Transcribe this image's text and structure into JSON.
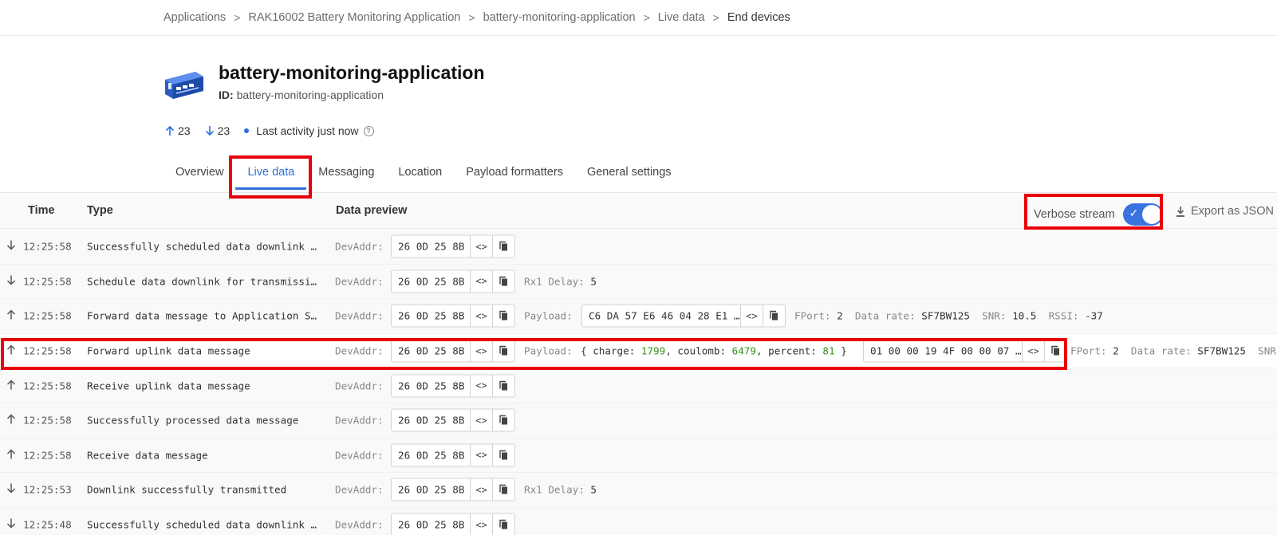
{
  "breadcrumb": {
    "items": [
      "Applications",
      "RAK16002 Battery Monitoring Application",
      "battery-monitoring-application",
      "Live data",
      "End devices"
    ],
    "separator": ">"
  },
  "header": {
    "title": "battery-monitoring-application",
    "id_label": "ID:",
    "id_value": "battery-monitoring-application",
    "icon": "device-board-icon"
  },
  "stats": {
    "uplink_count": "23",
    "downlink_count": "23",
    "activity": "Last activity just now",
    "help": "?"
  },
  "tabs": [
    "Overview",
    "Live data",
    "Messaging",
    "Location",
    "Payload formatters",
    "General settings"
  ],
  "active_tab": "Live data",
  "table": {
    "headers": {
      "time": "Time",
      "type": "Type",
      "preview": "Data preview"
    },
    "verbose_label": "Verbose stream",
    "verbose_check": "✓",
    "verbose_on": true,
    "export_label": "Export as JSON",
    "devaddr_label": "DevAddr:",
    "code_glyph": "<>"
  },
  "rows": [
    {
      "dir": "down",
      "time": "12:25:58",
      "type": "Successfully scheduled data downlink …",
      "devaddr": "26 0D 25 8B"
    },
    {
      "dir": "down",
      "time": "12:25:58",
      "type": "Schedule data downlink for transmissi…",
      "devaddr": "26 0D 25 8B",
      "rx_label": "Rx1 Delay:",
      "rx_value": "5"
    },
    {
      "dir": "up",
      "time": "12:25:58",
      "type": "Forward data message to Application S…",
      "devaddr": "26 0D 25 8B",
      "payload_label": "Payload:",
      "payload_hex": "C6 DA 57 E6 46 04 28 E1 …",
      "fport_label": "FPort:",
      "fport": "2",
      "datarate_label": "Data rate:",
      "datarate": "SF7BW125",
      "snr_label": "SNR:",
      "snr": "10.5",
      "rssi_label": "RSSI:",
      "rssi": "-37"
    },
    {
      "dir": "up",
      "time": "12:25:58",
      "type": "Forward uplink data message",
      "devaddr": "26 0D 25 8B",
      "payload_label": "Payload:",
      "decoded_open": "{",
      "charge_key": "charge:",
      "charge": "1799",
      "coulomb_key": "coulomb:",
      "coulomb": "6479",
      "percent_key": "percent:",
      "percent": "81",
      "decoded_close": "}",
      "payload_hex": "01 00 00 19 4F 00 00 07 …",
      "fport_label": "FPort:",
      "fport": "2",
      "datarate_label": "Data rate:",
      "datarate": "SF7BW125",
      "snr_label": "SNR:"
    },
    {
      "dir": "up",
      "time": "12:25:58",
      "type": "Receive uplink data message",
      "devaddr": "26 0D 25 8B"
    },
    {
      "dir": "up",
      "time": "12:25:58",
      "type": "Successfully processed data message",
      "devaddr": "26 0D 25 8B"
    },
    {
      "dir": "up",
      "time": "12:25:58",
      "type": "Receive data message",
      "devaddr": "26 0D 25 8B"
    },
    {
      "dir": "down",
      "time": "12:25:53",
      "type": "Downlink successfully transmitted",
      "devaddr": "26 0D 25 8B",
      "rx_label": "Rx1 Delay:",
      "rx_value": "5"
    },
    {
      "dir": "down",
      "time": "12:25:48",
      "type": "Successfully scheduled data downlink …",
      "devaddr": "26 0D 25 8B"
    }
  ],
  "colors": {
    "accent": "#2f6fdd",
    "highlight": "#e8000b",
    "number": "#3a8f1d"
  }
}
